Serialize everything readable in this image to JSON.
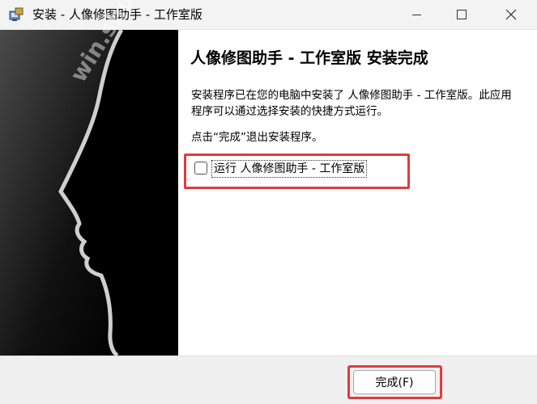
{
  "window": {
    "title": "安装 - 人像修图助手 - 工作室版",
    "minimize_icon": "minimize-icon",
    "maximize_icon": "maximize-icon",
    "close_icon": "close-icon"
  },
  "watermark": "win.shuiche.com",
  "content": {
    "heading": "人像修图助手 - 工作室版 安装完成",
    "description": "安装程序已在您的电脑中安装了 人像修图助手 - 工作室版。此应用程序可以通过选择安装的快捷方式运行。",
    "hint": "点击“完成”退出安装程序。",
    "run_checkbox_label": "运行  人像修图助手 - 工作室版",
    "run_checkbox_checked": false
  },
  "footer": {
    "finish_label": "完成(F)"
  },
  "colors": {
    "highlight": "#e23b3b",
    "titlebar": "#f3f3f3",
    "footer": "#f0f0f0"
  }
}
